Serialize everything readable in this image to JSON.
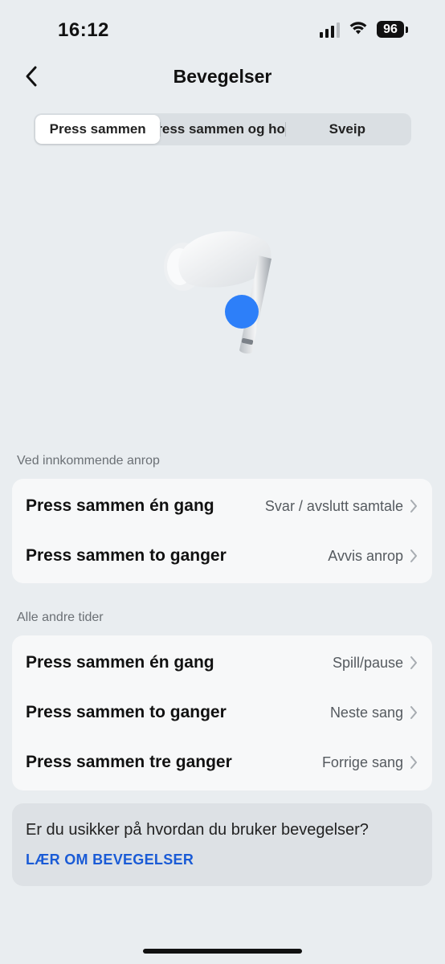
{
  "status_bar": {
    "time": "16:12",
    "battery": "96",
    "icons": [
      "signal-icon",
      "wifi-icon",
      "battery-icon"
    ]
  },
  "nav": {
    "title": "Bevegelser",
    "back_icon": "chevron-left-icon"
  },
  "tabs": [
    {
      "label": "Press sammen",
      "active": true
    },
    {
      "label": "Press sammen og hold",
      "active": false
    },
    {
      "label": "Sveip",
      "active": false
    }
  ],
  "illustration": {
    "name": "earbud-illustration",
    "accent_color": "#2d7ff9"
  },
  "incoming_call": {
    "header": "Ved innkommende anrop",
    "rows": [
      {
        "label": "Press sammen én gang",
        "value": "Svar / avslutt samtale"
      },
      {
        "label": "Press sammen to ganger",
        "value": "Avvis anrop"
      }
    ]
  },
  "other_times": {
    "header": "Alle andre tider",
    "rows": [
      {
        "label": "Press sammen én gang",
        "value": "Spill/pause"
      },
      {
        "label": "Press sammen to ganger",
        "value": "Neste sang"
      },
      {
        "label": "Press sammen tre ganger",
        "value": "Forrige sang"
      }
    ]
  },
  "help": {
    "question": "Er du usikker på hvordan du bruker bevegelser?",
    "link": "LÆR OM BEVEGELSER",
    "link_color": "#1a5bd6"
  },
  "colors": {
    "background": "#e9edf0",
    "card": "#f7f8f9",
    "help_card": "#dde1e5"
  }
}
